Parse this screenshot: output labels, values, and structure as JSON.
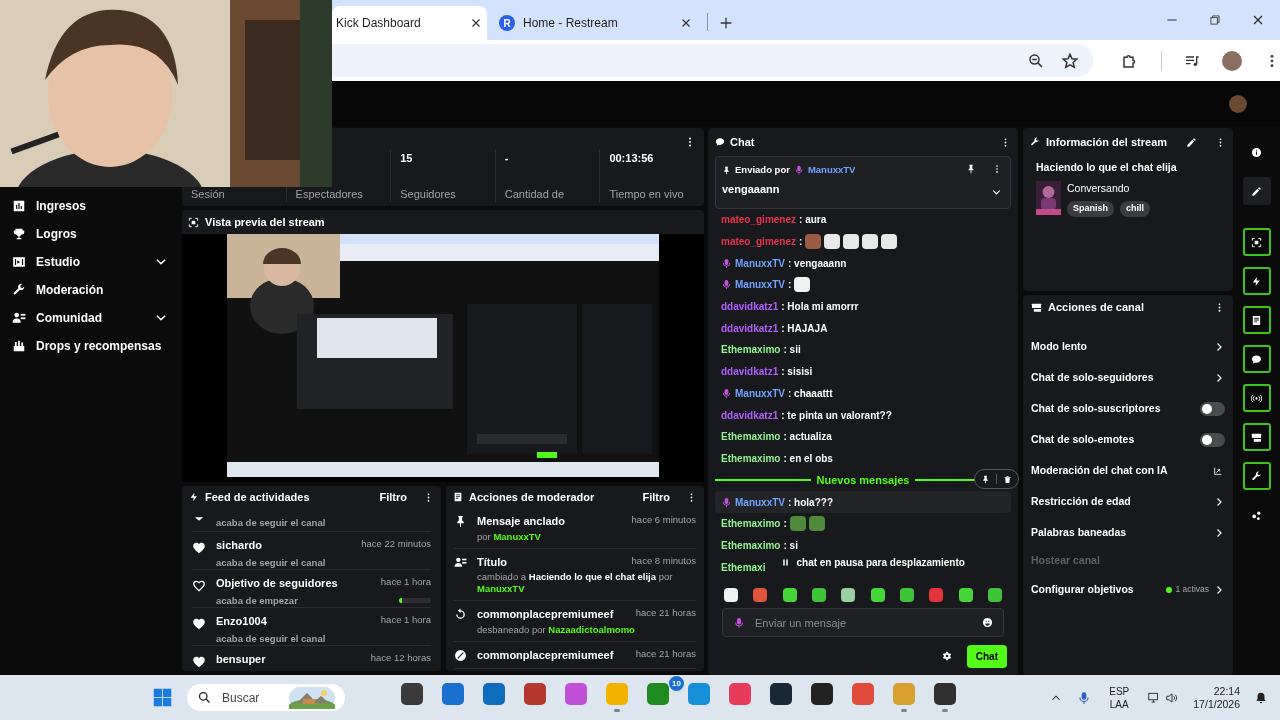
{
  "browser": {
    "tabs": [
      {
        "label": "Kick Dashboard",
        "selected": true
      },
      {
        "label": "Home - Restream",
        "favicon": "R",
        "selected": false
      }
    ]
  },
  "sidebar": {
    "items": [
      {
        "label": "Ingresos",
        "kind": "chart"
      },
      {
        "label": "Logros",
        "kind": "trophy"
      },
      {
        "label": "Estudio",
        "kind": "film",
        "expanded": false
      },
      {
        "label": "Moderación",
        "kind": "wrench"
      },
      {
        "label": "Comunidad",
        "kind": "users",
        "expanded": false
      },
      {
        "label": "Drops y recompensas",
        "kind": "gift"
      }
    ]
  },
  "stats": [
    {
      "label": "Sesión"
    },
    {
      "label": "Espectadores"
    },
    {
      "value": "15",
      "label": "Seguidores"
    },
    {
      "value": "-",
      "label": "Cantidad de"
    },
    {
      "value": "00:13:56",
      "label": "Tiempo en vivo"
    }
  ],
  "preview": {
    "title": "Vista previa del stream"
  },
  "feed": {
    "title": "Feed de actividades",
    "filter": "Filtro",
    "items": [
      {
        "kind": "caret",
        "subtitle": "acaba de seguir el canal"
      },
      {
        "kind": "follow",
        "title": "sichardo",
        "time": "hace 22 minutos",
        "subtitle": "acaba de seguir el canal"
      },
      {
        "kind": "goal",
        "title": "Objetivo de seguidores",
        "time": "hace 1 hora",
        "subtitle": "acaba de empezar",
        "level": 0.08
      },
      {
        "kind": "follow",
        "title": "Enzo1004",
        "time": "hace 1 hora",
        "subtitle": "acaba de seguir el canal"
      },
      {
        "kind": "follow",
        "title": "bensuper",
        "time": "hace 12 horas"
      }
    ]
  },
  "mod_actions": {
    "title": "Acciones de moderador",
    "filter": "Filtro",
    "items": [
      {
        "kind": "pin",
        "title": "Mensaje anclado",
        "time": "hace 6 minutos",
        "detail": "por",
        "user": "ManuxxTV"
      },
      {
        "kind": "title",
        "title": "Título",
        "time": "hace 8 minutos",
        "detail": "cambiado a **Haciendo lo que el chat elija** por",
        "user": "ManuxxTV"
      },
      {
        "kind": "unban",
        "title": "commonplacepremiumeef",
        "time": "hace 21 horas",
        "detail": "desbaneado por",
        "user": "Nazaadictoalmomo"
      },
      {
        "kind": "ban",
        "title": "commonplacepremiumeef",
        "time": "hace 21 horas"
      }
    ]
  },
  "chat": {
    "title": "Chat",
    "pinned": {
      "label": "Enviado por",
      "user": "ManuxxTV",
      "text": "vengaaann"
    },
    "messages": [
      {
        "kind": "message",
        "user": "mateo_gimenez",
        "color": "#e8324f",
        "mod": false,
        "text": ": aura",
        "hovered": false
      },
      {
        "kind": "message",
        "user": "mateo_gimenez",
        "color": "#e8324f",
        "mod": false,
        "text": ":",
        "emotes": [
          {
            "color": "#9a5a44"
          },
          {
            "color": "#e8e8e8"
          },
          {
            "color": "#e8e8e8"
          },
          {
            "color": "#e8e8e8"
          },
          {
            "color": "#e8e8e8"
          }
        ],
        "hovered": false
      },
      {
        "kind": "message",
        "user": "ManuxxTV",
        "color": "#6fa3ff",
        "mod": true,
        "text": ": vengaaann",
        "hovered": false
      },
      {
        "kind": "message",
        "user": "ManuxxTV",
        "color": "#6fa3ff",
        "mod": true,
        "text": ":",
        "emotes": [
          {
            "color": "#f2f2f2"
          }
        ],
        "hovered": false
      },
      {
        "kind": "message",
        "user": "ddavidkatz1",
        "color": "#b35cff",
        "mod": false,
        "text": ": Hola mi amorrr",
        "hovered": false
      },
      {
        "kind": "message",
        "user": "ddavidkatz1",
        "color": "#b35cff",
        "mod": false,
        "text": ": HAJAJA",
        "hovered": false
      },
      {
        "kind": "message",
        "user": "Ethemaximo",
        "color": "#8ef58e",
        "mod": false,
        "text": ": sii",
        "hovered": false
      },
      {
        "kind": "message",
        "user": "ddavidkatz1",
        "color": "#b35cff",
        "mod": false,
        "text": ": sisisi",
        "hovered": false
      },
      {
        "kind": "message",
        "user": "ManuxxTV",
        "color": "#6fa3ff",
        "mod": true,
        "text": ": chaaattt",
        "hovered": false
      },
      {
        "kind": "message",
        "user": "ddavidkatz1",
        "color": "#b35cff",
        "mod": false,
        "text": ": te pinta un valorant??",
        "hovered": false
      },
      {
        "kind": "message",
        "user": "Ethemaximo",
        "color": "#8ef58e",
        "mod": false,
        "text": ": actualiza",
        "hovered": false
      },
      {
        "kind": "message",
        "user": "Ethemaximo",
        "color": "#8ef58e",
        "mod": false,
        "text": ": en el obs",
        "hovered": false
      },
      {
        "kind": "divider",
        "text": "Nuevos mensajes"
      },
      {
        "kind": "message",
        "user": "ManuxxTV",
        "color": "#6fa3ff",
        "mod": true,
        "text": ": hola???",
        "hovered": true
      },
      {
        "kind": "message",
        "user": "Ethemaximo",
        "color": "#8ef58e",
        "mod": false,
        "text": ":",
        "emotes": [
          {
            "color": "#4e8a3a"
          },
          {
            "color": "#4e8a3a"
          }
        ],
        "hovered": false
      },
      {
        "kind": "message",
        "user": "Ethemaximo",
        "color": "#8ef58e",
        "mod": false,
        "text": ": si",
        "hovered": false
      },
      {
        "kind": "message",
        "user": "Ethemaxi",
        "color": "#8ef58e",
        "mod": false,
        "hovered": false
      }
    ],
    "paused": "chat en pausa para desplazamiento",
    "emote_bar": [
      {
        "color": "#f2f2f2"
      },
      {
        "color": "#e0553a"
      },
      {
        "color": "#45d63a"
      },
      {
        "color": "#3fc43a"
      },
      {
        "color": "#9ad0a0"
      },
      {
        "color": "#45d63a"
      },
      {
        "color": "#3fc43a"
      },
      {
        "color": "#e0343a"
      },
      {
        "color": "#45d63a"
      },
      {
        "color": "#3fc43a"
      }
    ],
    "input": {
      "placeholder": "Enviar un mensaje"
    },
    "send": "Chat"
  },
  "stream_info": {
    "title": "Información del stream",
    "stream_title": "Haciendo lo que el chat elija",
    "category": "Conversando",
    "tags": [
      "Spanish",
      "chill"
    ]
  },
  "channel_actions": {
    "title": "Acciones de canal",
    "items": [
      {
        "kind": "link",
        "label": "Modo lento"
      },
      {
        "kind": "link",
        "label": "Chat de solo-seguidores"
      },
      {
        "kind": "toggle",
        "label": "Chat de solo-suscriptores",
        "on": false
      },
      {
        "kind": "toggle",
        "label": "Chat de solo-emotes",
        "on": false
      },
      {
        "kind": "external",
        "label": "Moderación del chat con IA"
      },
      {
        "kind": "link",
        "label": "Restricción de edad"
      },
      {
        "kind": "link",
        "label": "Palabras baneadas"
      },
      {
        "kind": "disabled",
        "label": "Hostear canal"
      },
      {
        "kind": "goal",
        "label": "Configurar objetivos",
        "status": "1 activas"
      }
    ]
  },
  "rail": [
    {
      "kind": "info",
      "on": false
    },
    {
      "kind": "edit",
      "on": false
    },
    {
      "kind": "scan",
      "on": true
    },
    {
      "kind": "bolt",
      "on": true
    },
    {
      "kind": "doc",
      "on": true
    },
    {
      "kind": "chat",
      "on": true
    },
    {
      "kind": "broadcast",
      "on": true
    },
    {
      "kind": "cam",
      "on": true
    },
    {
      "kind": "wrench",
      "on": true
    },
    {
      "kind": "dots",
      "on": false
    }
  ],
  "taskbar": {
    "search": "Buscar",
    "apps": [
      {
        "color": "#3a3a3a",
        "running": false
      },
      {
        "color": "#1a6fd0",
        "running": false
      },
      {
        "color": "#0f6cbd",
        "running": false
      },
      {
        "color": "#b5382c",
        "running": false
      },
      {
        "color": "#c04fd8",
        "running": false
      },
      {
        "color": "#f2b300",
        "running": true
      },
      {
        "color": "#1f8a1f",
        "running": false,
        "badge": "10"
      },
      {
        "color": "#1590d8",
        "running": false
      },
      {
        "color": "#e83a5a",
        "running": false
      },
      {
        "color": "#1b2838",
        "running": false
      },
      {
        "color": "#222222",
        "running": false
      },
      {
        "color": "#e04a3a",
        "running": false
      },
      {
        "color": "#d8a030",
        "running": true
      },
      {
        "color": "#303030",
        "running": true
      }
    ],
    "lang": "ESP",
    "layout": "LAA",
    "time": "22:14",
    "date": "17/1/2026"
  }
}
